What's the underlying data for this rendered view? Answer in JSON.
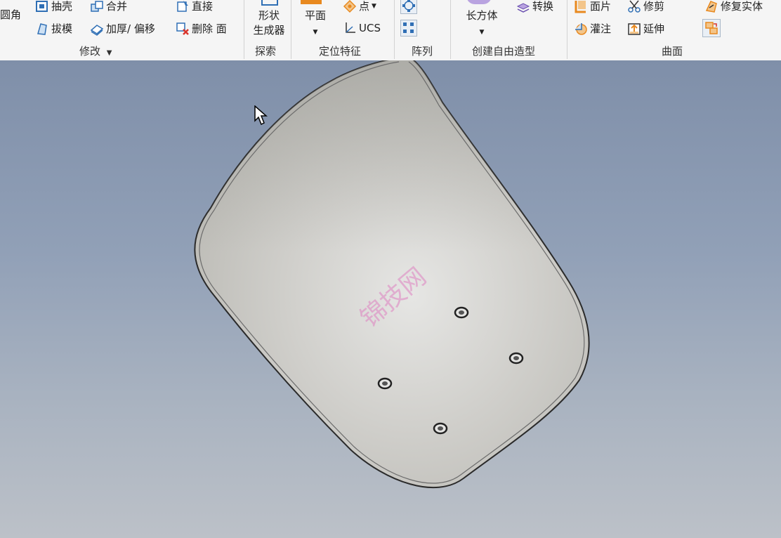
{
  "ribbon": {
    "modify": {
      "fillet": "圆角",
      "shell": "抽壳",
      "combine": "合并",
      "direct": "直接",
      "draft": "拔模",
      "thicken": "加厚/ 偏移",
      "delete_face": "删除 面",
      "group_label": "修改",
      "dropdown_glyph": "▼"
    },
    "explore": {
      "shape_generator": "形状\n生成器",
      "group_label": "探索"
    },
    "work_features": {
      "plane": "平面",
      "point": "点",
      "ucs": "UCS",
      "group_label": "定位特征"
    },
    "pattern": {
      "group_label": "阵列"
    },
    "freeform": {
      "box": "长方体",
      "convert": "转换",
      "group_label": "创建自由造型"
    },
    "surface": {
      "patch": "面片",
      "trim": "修剪",
      "repair": "修复实体",
      "sculpt": "灌注",
      "extend": "延伸",
      "group_label": "曲面"
    }
  },
  "viewport": {
    "watermark": "锦技网"
  },
  "colors": {
    "ribbon_bg": "#f5f5f5",
    "viewport_top": "#7f8fa9",
    "viewport_bottom": "#bcc1c8",
    "part_face": "#cfcdca",
    "icon_blue": "#2f6fb5",
    "icon_orange": "#e8891f"
  }
}
